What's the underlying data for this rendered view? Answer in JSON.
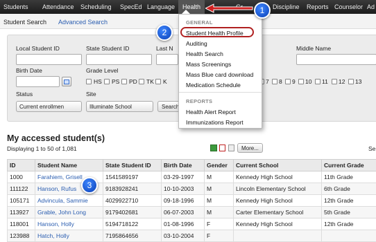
{
  "topnav": {
    "items": [
      "Students",
      "Attendance",
      "Scheduling",
      "SpecEd",
      "Language",
      "Health",
      "Discipline",
      "Reports",
      "Counselor",
      "Ad"
    ],
    "partial_item": "Gr"
  },
  "subnav": {
    "title": "Student Search",
    "link": "Advanced Search"
  },
  "search": {
    "local_id_label": "Local Student ID",
    "state_id_label": "State Student ID",
    "last_name_label": "Last N",
    "middle_name_label": "Middle Name",
    "birth_date_label": "Birth Date",
    "grade_level_label": "Grade Level",
    "grades": [
      "HS",
      "PS",
      "PD",
      "TK",
      "K"
    ],
    "grades_right": [
      "7",
      "8",
      "9",
      "10",
      "11",
      "12",
      "13"
    ],
    "status_label": "Status",
    "status_value": "Current enrollmen",
    "site_label": "Site",
    "site_value": "Illuminate School",
    "search_button": "Search"
  },
  "menu": {
    "general_header": "GENERAL",
    "general_items": [
      "Student Health Profile",
      "Auditing",
      "Health Search",
      "Mass Screenings",
      "Mass Blue card download",
      "Medication Schedule"
    ],
    "reports_header": "REPORTS",
    "reports_items": [
      "Health Alert Report",
      "Immunizations Report"
    ]
  },
  "callouts": [
    "1",
    "2",
    "3"
  ],
  "results": {
    "heading": "My accessed student(s)",
    "displaying": "Displaying 1 to 50 of 1,081",
    "more_button": "More...",
    "cut_label": "Se",
    "columns": [
      "ID",
      "Student Name",
      "State Student ID",
      "Birth Date",
      "Gender",
      "Current School",
      "Current Grade"
    ],
    "rows": [
      [
        "1000",
        "Farahiem, Grisell",
        "1541589197",
        "03-29-1997",
        "M",
        "Kennedy High School",
        "11th Grade"
      ],
      [
        "111122",
        "Hanson, Rufus",
        "9183928241",
        "10-10-2003",
        "M",
        "Lincoln Elementary School",
        "6th Grade"
      ],
      [
        "105171",
        "Advincula, Sammie",
        "4029922710",
        "09-18-1996",
        "M",
        "Kennedy High School",
        "12th Grade"
      ],
      [
        "113927",
        "Grable, John Long",
        "9179402681",
        "06-07-2003",
        "M",
        "Carter Elementary School",
        "5th Grade"
      ],
      [
        "118001",
        "Hanson, Holly",
        "5194718122",
        "01-08-1996",
        "F",
        "Kennedy High School",
        "12th Grade"
      ],
      [
        "123988",
        "Hatch, Holly",
        "7195864656",
        "03-10-2004",
        "F",
        "",
        ""
      ]
    ]
  },
  "colors": {
    "nav_bg": "#2a2a2a",
    "link": "#2a5db0",
    "highlight": "#b02020",
    "arrow": "#d02020",
    "callout": "#1a55d6"
  }
}
